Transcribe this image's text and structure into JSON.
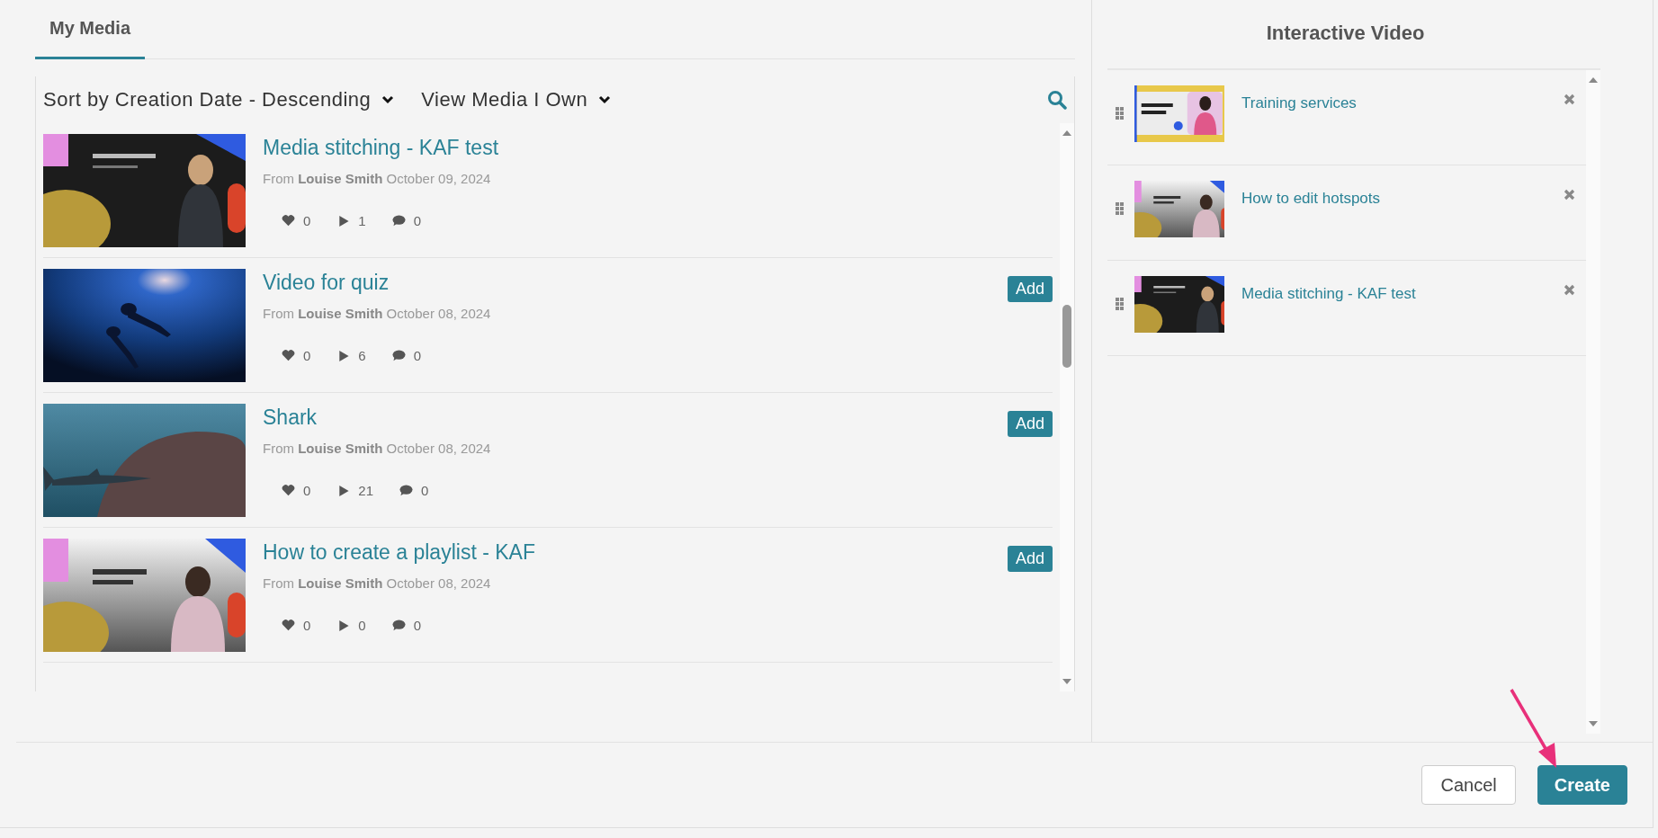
{
  "tabs": [
    {
      "label": "My Media",
      "selected": true
    }
  ],
  "toolbar": {
    "sort": "Sort by Creation Date - Descending",
    "filter": "View Media I Own"
  },
  "media": [
    {
      "title": "Media stitching - KAF test",
      "from": "From",
      "owner": "Louise Smith",
      "date": "October 09, 2024",
      "likes": "0",
      "plays": "1",
      "comments": "0"
    },
    {
      "title": "Video for quiz",
      "from": "From",
      "owner": "Louise Smith",
      "date": "October 08, 2024",
      "likes": "0",
      "plays": "6",
      "comments": "0",
      "add": "Add"
    },
    {
      "title": "Shark",
      "from": "From",
      "owner": "Louise Smith",
      "date": "October 08, 2024",
      "likes": "0",
      "plays": "21",
      "comments": "0",
      "add": "Add"
    },
    {
      "title": "How to create a playlist - KAF",
      "from": "From",
      "owner": "Louise Smith",
      "date": "October 08, 2024",
      "likes": "0",
      "plays": "0",
      "comments": "0",
      "add": "Add"
    }
  ],
  "panel": {
    "title": "Interactive Video",
    "items": [
      {
        "title": "Training services"
      },
      {
        "title": "How to edit hotspots"
      },
      {
        "title": "Media stitching - KAF test"
      }
    ]
  },
  "buttons": {
    "cancel": "Cancel",
    "create": "Create"
  }
}
